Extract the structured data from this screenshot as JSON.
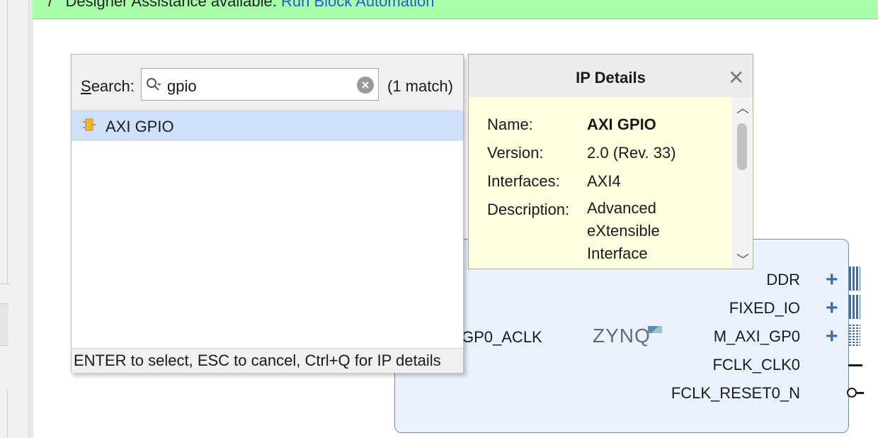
{
  "banner": {
    "icon": "pencil-icon",
    "prefix": "/",
    "text": "Designer Assistance available.",
    "link": "Run Block Automation"
  },
  "search_popup": {
    "label_underlined": "S",
    "label_rest": "earch:",
    "value": "gpio",
    "match_count": "(1 match)",
    "results": [
      {
        "label": "AXI GPIO",
        "icon": "ip-core-icon",
        "selected": true
      }
    ],
    "footer": "ENTER to select, ESC to cancel, Ctrl+Q for IP details"
  },
  "ip_details": {
    "title": "IP Details",
    "name_key": "Name:",
    "name_value": "AXI GPIO",
    "version_key": "Version:",
    "version_value": "2.0 (Rev. 33)",
    "interfaces_key": "Interfaces:",
    "interfaces_value": "AXI4",
    "description_key": "Description:",
    "description_lines": [
      "Advanced",
      "eXtensible",
      "Interface"
    ]
  },
  "zynq_block": {
    "logo": "ZYNQ",
    "left_port": "GP0_ACLK",
    "ports": [
      {
        "label": "DDR",
        "connector": "bus-plus"
      },
      {
        "label": "FIXED_IO",
        "connector": "bus-plus"
      },
      {
        "label": "M_AXI_GP0",
        "connector": "bus-plus-dotted"
      },
      {
        "label": "FCLK_CLK0",
        "connector": "wire"
      },
      {
        "label": "FCLK_RESET0_N",
        "connector": "inverted-wire"
      }
    ]
  },
  "colors": {
    "banner_bg": "#aaffaa",
    "link": "#1a5fd6",
    "block_fill": "#eaf3fd",
    "bus": "#3e6da6",
    "selection": "#cfe0fb",
    "tooltip_bg": "#fefee0"
  }
}
